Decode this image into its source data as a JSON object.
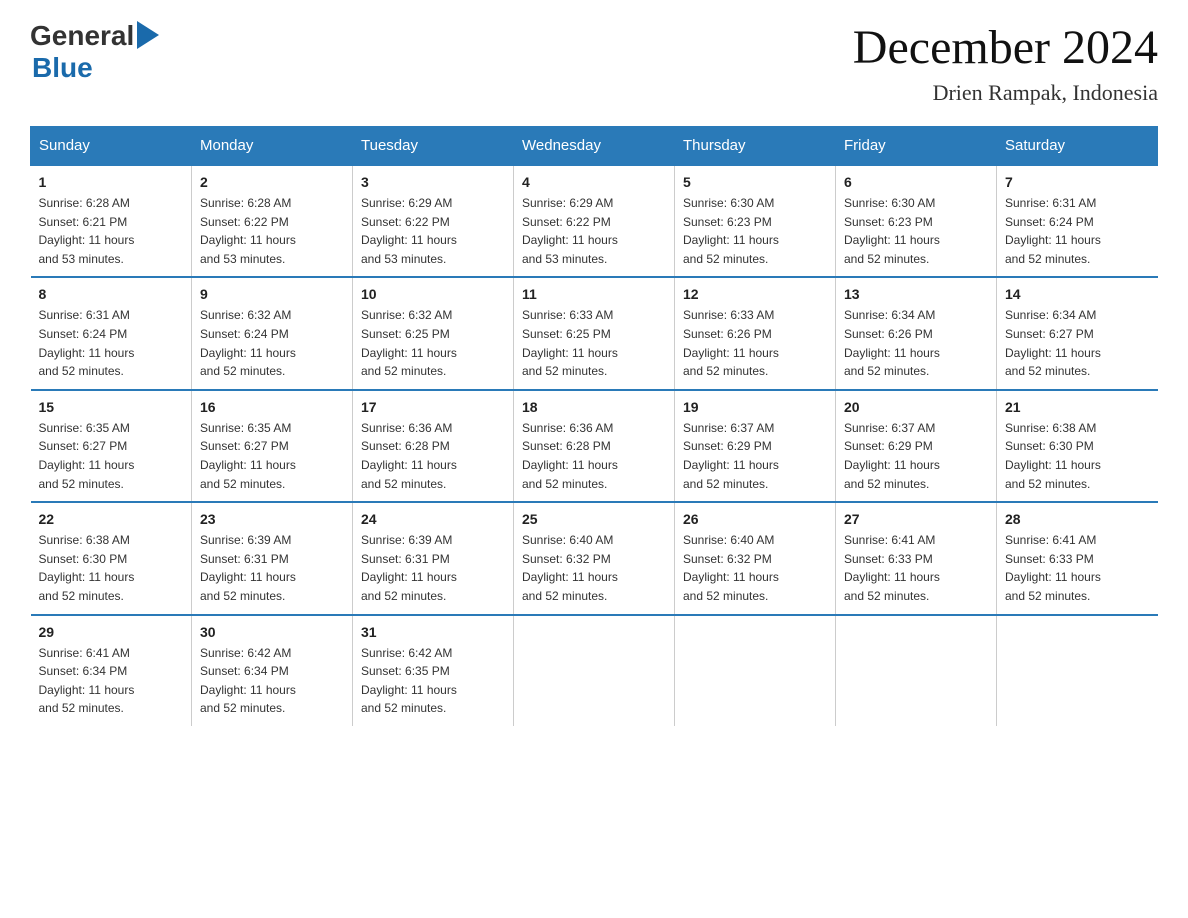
{
  "header": {
    "logo_general": "General",
    "logo_blue": "Blue",
    "month_title": "December 2024",
    "location": "Drien Rampak, Indonesia"
  },
  "days_of_week": [
    "Sunday",
    "Monday",
    "Tuesday",
    "Wednesday",
    "Thursday",
    "Friday",
    "Saturday"
  ],
  "weeks": [
    [
      {
        "day": "1",
        "sunrise": "6:28 AM",
        "sunset": "6:21 PM",
        "daylight": "11 hours and 53 minutes."
      },
      {
        "day": "2",
        "sunrise": "6:28 AM",
        "sunset": "6:22 PM",
        "daylight": "11 hours and 53 minutes."
      },
      {
        "day": "3",
        "sunrise": "6:29 AM",
        "sunset": "6:22 PM",
        "daylight": "11 hours and 53 minutes."
      },
      {
        "day": "4",
        "sunrise": "6:29 AM",
        "sunset": "6:22 PM",
        "daylight": "11 hours and 53 minutes."
      },
      {
        "day": "5",
        "sunrise": "6:30 AM",
        "sunset": "6:23 PM",
        "daylight": "11 hours and 52 minutes."
      },
      {
        "day": "6",
        "sunrise": "6:30 AM",
        "sunset": "6:23 PM",
        "daylight": "11 hours and 52 minutes."
      },
      {
        "day": "7",
        "sunrise": "6:31 AM",
        "sunset": "6:24 PM",
        "daylight": "11 hours and 52 minutes."
      }
    ],
    [
      {
        "day": "8",
        "sunrise": "6:31 AM",
        "sunset": "6:24 PM",
        "daylight": "11 hours and 52 minutes."
      },
      {
        "day": "9",
        "sunrise": "6:32 AM",
        "sunset": "6:24 PM",
        "daylight": "11 hours and 52 minutes."
      },
      {
        "day": "10",
        "sunrise": "6:32 AM",
        "sunset": "6:25 PM",
        "daylight": "11 hours and 52 minutes."
      },
      {
        "day": "11",
        "sunrise": "6:33 AM",
        "sunset": "6:25 PM",
        "daylight": "11 hours and 52 minutes."
      },
      {
        "day": "12",
        "sunrise": "6:33 AM",
        "sunset": "6:26 PM",
        "daylight": "11 hours and 52 minutes."
      },
      {
        "day": "13",
        "sunrise": "6:34 AM",
        "sunset": "6:26 PM",
        "daylight": "11 hours and 52 minutes."
      },
      {
        "day": "14",
        "sunrise": "6:34 AM",
        "sunset": "6:27 PM",
        "daylight": "11 hours and 52 minutes."
      }
    ],
    [
      {
        "day": "15",
        "sunrise": "6:35 AM",
        "sunset": "6:27 PM",
        "daylight": "11 hours and 52 minutes."
      },
      {
        "day": "16",
        "sunrise": "6:35 AM",
        "sunset": "6:27 PM",
        "daylight": "11 hours and 52 minutes."
      },
      {
        "day": "17",
        "sunrise": "6:36 AM",
        "sunset": "6:28 PM",
        "daylight": "11 hours and 52 minutes."
      },
      {
        "day": "18",
        "sunrise": "6:36 AM",
        "sunset": "6:28 PM",
        "daylight": "11 hours and 52 minutes."
      },
      {
        "day": "19",
        "sunrise": "6:37 AM",
        "sunset": "6:29 PM",
        "daylight": "11 hours and 52 minutes."
      },
      {
        "day": "20",
        "sunrise": "6:37 AM",
        "sunset": "6:29 PM",
        "daylight": "11 hours and 52 minutes."
      },
      {
        "day": "21",
        "sunrise": "6:38 AM",
        "sunset": "6:30 PM",
        "daylight": "11 hours and 52 minutes."
      }
    ],
    [
      {
        "day": "22",
        "sunrise": "6:38 AM",
        "sunset": "6:30 PM",
        "daylight": "11 hours and 52 minutes."
      },
      {
        "day": "23",
        "sunrise": "6:39 AM",
        "sunset": "6:31 PM",
        "daylight": "11 hours and 52 minutes."
      },
      {
        "day": "24",
        "sunrise": "6:39 AM",
        "sunset": "6:31 PM",
        "daylight": "11 hours and 52 minutes."
      },
      {
        "day": "25",
        "sunrise": "6:40 AM",
        "sunset": "6:32 PM",
        "daylight": "11 hours and 52 minutes."
      },
      {
        "day": "26",
        "sunrise": "6:40 AM",
        "sunset": "6:32 PM",
        "daylight": "11 hours and 52 minutes."
      },
      {
        "day": "27",
        "sunrise": "6:41 AM",
        "sunset": "6:33 PM",
        "daylight": "11 hours and 52 minutes."
      },
      {
        "day": "28",
        "sunrise": "6:41 AM",
        "sunset": "6:33 PM",
        "daylight": "11 hours and 52 minutes."
      }
    ],
    [
      {
        "day": "29",
        "sunrise": "6:41 AM",
        "sunset": "6:34 PM",
        "daylight": "11 hours and 52 minutes."
      },
      {
        "day": "30",
        "sunrise": "6:42 AM",
        "sunset": "6:34 PM",
        "daylight": "11 hours and 52 minutes."
      },
      {
        "day": "31",
        "sunrise": "6:42 AM",
        "sunset": "6:35 PM",
        "daylight": "11 hours and 52 minutes."
      },
      null,
      null,
      null,
      null
    ]
  ],
  "labels": {
    "sunrise": "Sunrise:",
    "sunset": "Sunset:",
    "daylight": "Daylight:"
  }
}
